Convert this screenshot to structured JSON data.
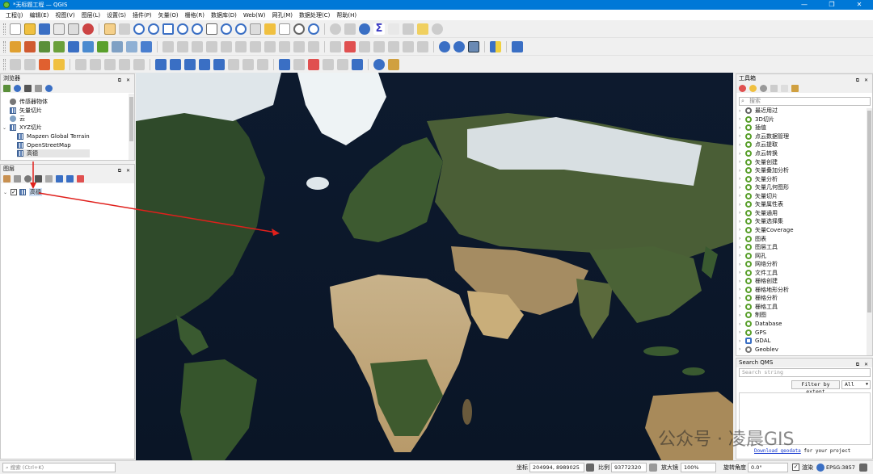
{
  "window": {
    "title": "*无标题工程 — QGIS",
    "controls": [
      "—",
      "❐",
      "✕"
    ]
  },
  "menu": [
    "工程(J)",
    "编辑(E)",
    "视图(V)",
    "图层(L)",
    "设置(S)",
    "插件(P)",
    "矢量(O)",
    "栅格(R)",
    "数据库(D)",
    "Web(W)",
    "网孔(M)",
    "数据处理(C)",
    "帮助(H)"
  ],
  "browser": {
    "title": "浏览器",
    "items": [
      "传感器物体",
      "矢量切片",
      "云",
      "XYZ切片",
      "Mapzen Global Terrain",
      "OpenStreetMap",
      "高德"
    ]
  },
  "layers": {
    "title": "图层",
    "layer_name": "高德"
  },
  "toolbox": {
    "title": "工具箱",
    "search_placeholder": "搜索",
    "groups": [
      "最近用过",
      "3D切片",
      "插值",
      "点云数据管理",
      "点云提取",
      "点云转换",
      "矢量创建",
      "矢量叠加分析",
      "矢量分析",
      "矢量几何图形",
      "矢量切片",
      "矢量属性表",
      "矢量通用",
      "矢量选择集",
      "矢量Coverage",
      "图表",
      "图层工具",
      "网孔",
      "网络分析",
      "文件工具",
      "栅格创建",
      "栅格地形分析",
      "栅格分析",
      "栅格工具",
      "制图",
      "Database",
      "GPS",
      "GDAL",
      "Geoblev"
    ]
  },
  "qms": {
    "title": "Search QMS",
    "search_placeholder": "Search string",
    "filter_label": "Filter by extent",
    "filter_value": "All",
    "footer_link": "Download geodata",
    "footer_rest": "for your project"
  },
  "statusbar": {
    "search_placeholder": "搜索 (Ctrl+K)",
    "coord_label": "坐标",
    "coord_value": "204994, 8989025",
    "scale_label": "比例",
    "scale_value": "93772320",
    "magnifier_label": "放大镜",
    "magnifier_value": "100%",
    "rotation_label": "旋转角度",
    "rotation_value": "0.0°",
    "render_label": "渲染",
    "crs": "EPSG:3857"
  },
  "watermark": "公众号 · 凌晨GIS",
  "colors": {
    "titlebar": "#0078d7",
    "arrow": "#e0201c",
    "qgis_green": "#5aa02c"
  }
}
